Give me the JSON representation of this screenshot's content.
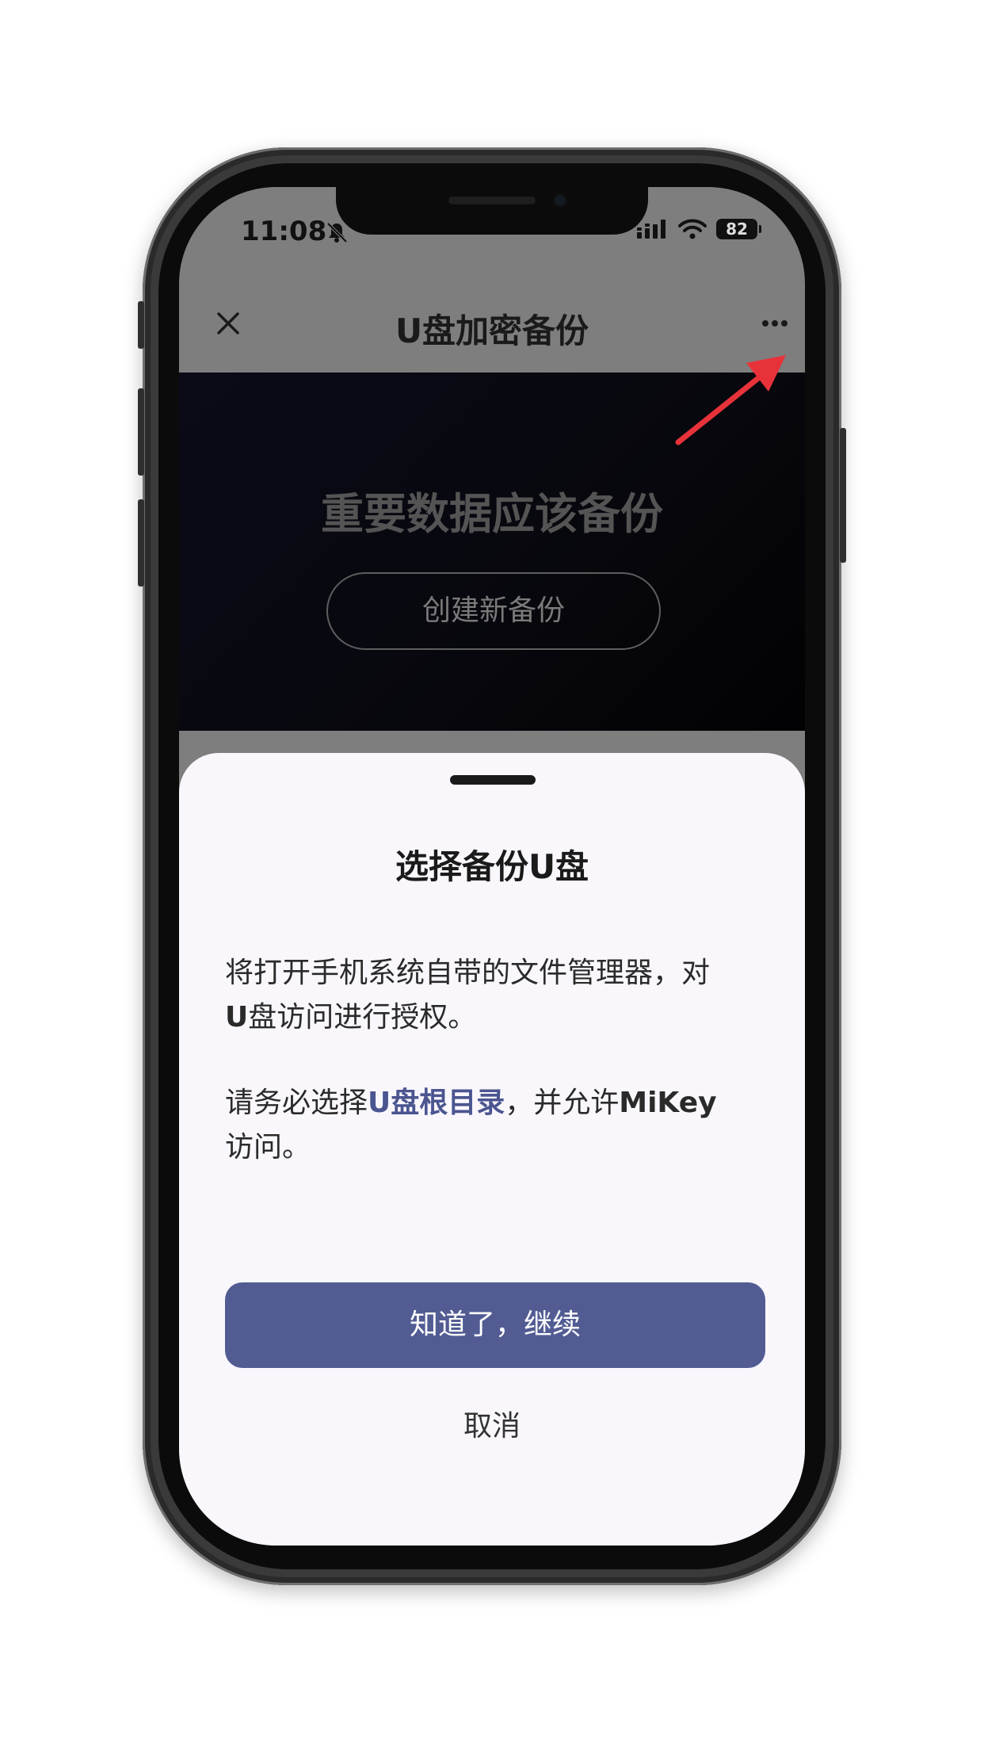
{
  "status_bar": {
    "time": "11:08",
    "battery": "82",
    "icons": [
      "bell-slash-icon",
      "signal-icon",
      "wifi-icon",
      "battery-icon"
    ]
  },
  "header": {
    "title": "U盘加密备份",
    "close_icon": "close-icon",
    "more_icon": "more-icon"
  },
  "hero": {
    "title": "重要数据应该备份",
    "button_label": "创建新备份"
  },
  "sheet": {
    "title": "选择备份U盘",
    "para1": {
      "line1": "将打开手机系统自带的文件管理器，对",
      "bold": "U",
      "rest": "盘访问进行授权。"
    },
    "para2": {
      "prefix": "请务必选择",
      "highlight": "U盘根目录",
      "middle": "，并允许",
      "bold": "MiKey",
      "suffix": "访问。"
    },
    "confirm_label": "知道了，继续",
    "cancel_label": "取消"
  },
  "colors": {
    "primary_button": "#525c93",
    "highlight_text": "#4b5590",
    "annotation_arrow": "#e8323a",
    "sheet_background": "#f9f7fc",
    "dim_overlay": "#7e7e7e"
  }
}
